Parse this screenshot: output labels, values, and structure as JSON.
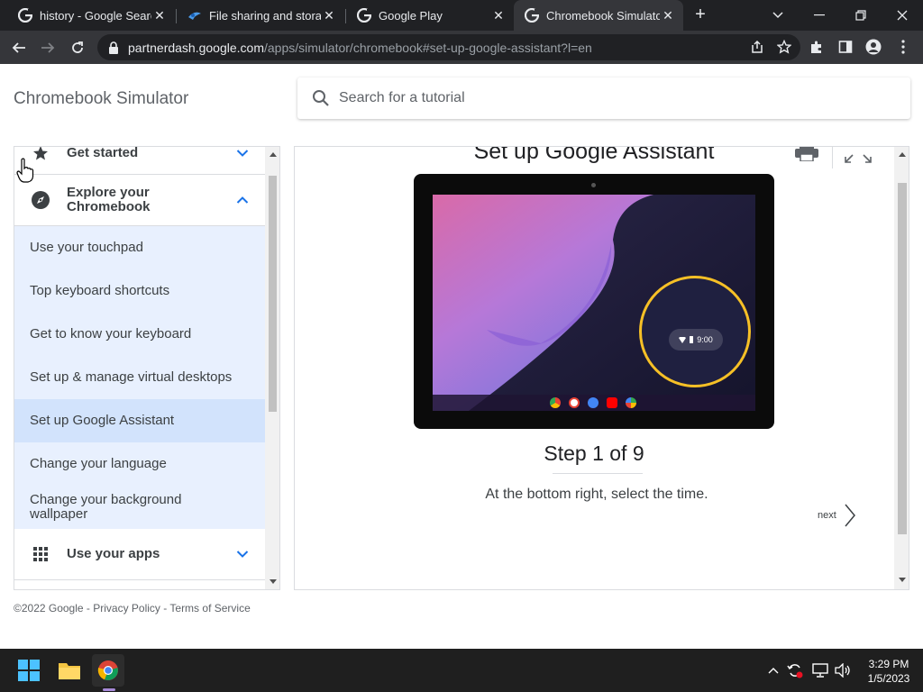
{
  "browser": {
    "tabs": [
      {
        "title": "history - Google Search",
        "favicon": "google-icon",
        "active": false
      },
      {
        "title": "File sharing and storage",
        "favicon": "drive-icon",
        "active": false
      },
      {
        "title": "Google Play",
        "favicon": "google-icon",
        "active": false
      },
      {
        "title": "Chromebook Simulator",
        "favicon": "google-icon",
        "active": true
      }
    ],
    "url_host": "partnerdash.google.com",
    "url_path": "/apps/simulator/chromebook#set-up-google-assistant?l=en"
  },
  "header": {
    "site_title": "Chromebook Simulator",
    "search_placeholder": "Search for a tutorial"
  },
  "sidebar": {
    "sections": [
      {
        "label": "Get started",
        "icon": "star-icon",
        "expanded": false
      },
      {
        "label": "Explore your Chromebook",
        "icon": "compass-icon",
        "expanded": true
      },
      {
        "label": "Use your apps",
        "icon": "apps-grid-icon",
        "expanded": false
      }
    ],
    "subitems": [
      "Use your touchpad",
      "Top keyboard shortcuts",
      "Get to know your keyboard",
      "Set up & manage virtual desktops",
      "Set up Google Assistant",
      "Change your language",
      "Change your background wallpaper"
    ],
    "active_subitem": "Set up Google Assistant"
  },
  "main": {
    "title": "Set up Google Assistant",
    "step": "Step 1 of 9",
    "instruction": "At the bottom right, select the time.",
    "next_label": "next",
    "screen_time": "9:00",
    "highlight_color": "#f6c026"
  },
  "footer": {
    "copyright": "©2022 Google",
    "sep1": " - ",
    "privacy": "Privacy Policy",
    "sep2": " - ",
    "terms": "Terms of Service"
  },
  "taskbar": {
    "time": "3:29 PM",
    "date": "1/5/2023"
  }
}
